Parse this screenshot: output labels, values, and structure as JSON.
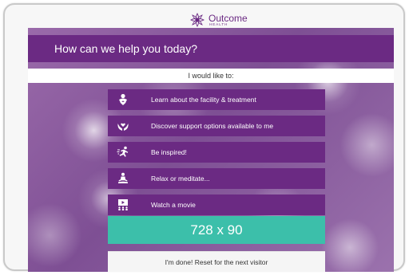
{
  "brand": {
    "name": "Outcome",
    "subtitle": "HEALTH",
    "color": "#6b2a83"
  },
  "header": {
    "title": "How can we help you today?"
  },
  "prompt": {
    "text": "I would like to:"
  },
  "menu": {
    "items": [
      {
        "label": "Learn about the facility & treatment",
        "icon": "person-heart-icon"
      },
      {
        "label": "Discover support options available to me",
        "icon": "hands-heart-icon"
      },
      {
        "label": "Be inspired!",
        "icon": "running-person-icon"
      },
      {
        "label": "Relax or meditate...",
        "icon": "meditation-icon"
      },
      {
        "label": "Watch a movie",
        "icon": "movie-audience-icon"
      }
    ]
  },
  "ad": {
    "text": "728 x 90",
    "color": "#3cbfaa"
  },
  "done": {
    "label": "I'm done! Reset for the next visitor"
  }
}
